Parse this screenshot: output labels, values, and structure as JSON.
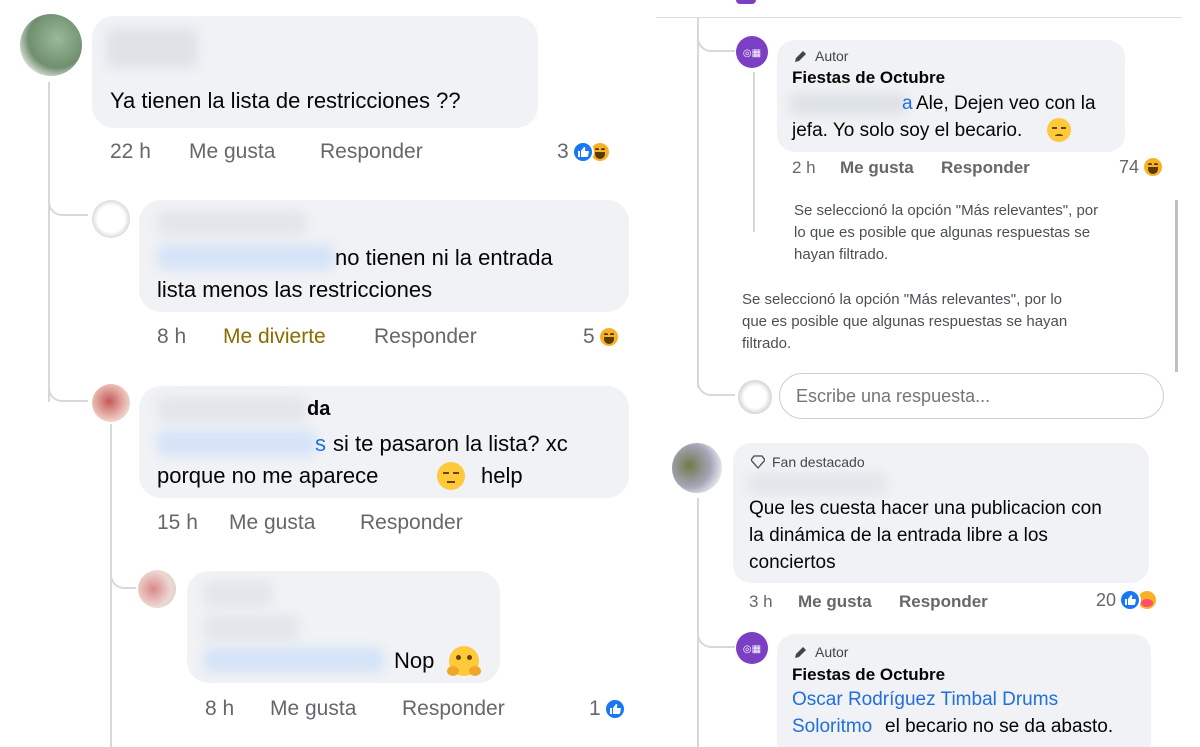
{
  "left": {
    "c1": {
      "text": "Ya tienen la lista de restricciones ??",
      "time": "22 h",
      "like": "Me gusta",
      "reply": "Responder",
      "count": "3"
    },
    "c2": {
      "text_a": "no tienen ni la entrada",
      "text_b": "lista menos las restricciones",
      "time": "8 h",
      "like": "Me divierte",
      "reply": "Responder",
      "count": "5"
    },
    "c3": {
      "name_tail": "da",
      "mention_tail": "s",
      "text_a": "si te pasaron la lista? xc",
      "text_b": "porque no me aparece",
      "text_c": "help",
      "time": "15 h",
      "like": "Me gusta",
      "reply": "Responder"
    },
    "c4": {
      "text": "Nop",
      "time": "8 h",
      "like": "Me gusta",
      "reply": "Responder",
      "count": "1"
    }
  },
  "right": {
    "r1": {
      "badge": "Autor",
      "name": "Fiestas de Octubre",
      "mention_tail": "a",
      "text_a": "Ale, Dejen veo con la",
      "text_b": "jefa. Yo solo soy el becario.",
      "time": "2 h",
      "like": "Me gusta",
      "reply": "Responder",
      "count": "74"
    },
    "notice_inner": [
      "Se seleccionó la opción \"Más relevantes\", por",
      "lo que es posible que algunas respuestas se",
      "hayan filtrado."
    ],
    "notice_outer": [
      "Se seleccionó la opción \"Más relevantes\", por lo",
      "que es posible que algunas respuestas se hayan",
      "filtrado."
    ],
    "reply_box": {
      "placeholder": "Escribe una respuesta..."
    },
    "r2": {
      "badge": "Fan destacado",
      "text_a": "Que les cuesta hacer una publicacion con",
      "text_b": "la dinámica de la entrada libre a los",
      "text_c": "conciertos",
      "time": "3 h",
      "like": "Me gusta",
      "reply": "Responder",
      "count": "20"
    },
    "r3": {
      "badge": "Autor",
      "name": "Fiestas de Octubre",
      "mention_a": "Oscar Rodríguez Timbal Drums",
      "mention_b": "Soloritmo",
      "text_b": "el becario no se da abasto."
    }
  },
  "colors": {
    "accent": "#1877f2",
    "link": "#216fdb",
    "page_avatar": "#7b3fc4",
    "bubble": "#f0f2f5",
    "meta": "#65676b"
  },
  "icons": [
    "like-reaction-icon",
    "haha-reaction-icon",
    "care-reaction-icon",
    "pencil-icon",
    "diamond-icon",
    "page-avatar-icon"
  ]
}
